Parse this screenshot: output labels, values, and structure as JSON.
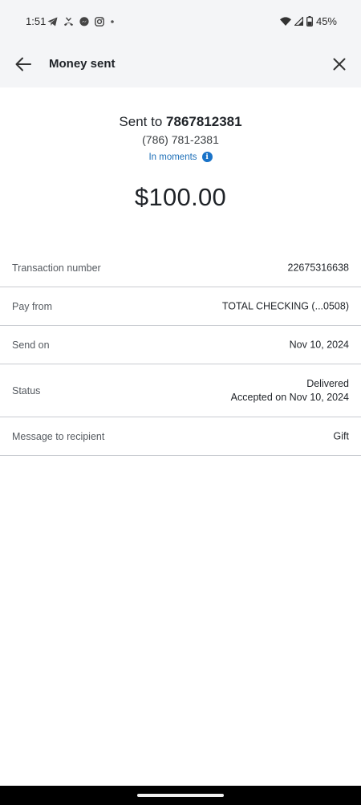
{
  "status_bar": {
    "time": "1:51",
    "battery": "45%",
    "icons": [
      "telegram-icon",
      "missed-call-icon",
      "messenger-icon",
      "instagram-icon",
      "notification-dot-icon",
      "wifi-icon",
      "signal-icon",
      "battery-icon"
    ]
  },
  "header": {
    "title": "Money sent",
    "back_icon": "arrow-left-icon",
    "close_icon": "close-icon"
  },
  "summary": {
    "sent_to_prefix": "Sent to",
    "recipient_number": "7867812381",
    "recipient_phone": "(786) 781-2381",
    "timing": "In moments",
    "amount": "$100.00"
  },
  "details": [
    {
      "label": "Transaction number",
      "value": "22675316638"
    },
    {
      "label": "Pay from",
      "value": "TOTAL CHECKING (...0508)"
    },
    {
      "label": "Send on",
      "value": "Nov 10, 2024"
    },
    {
      "label": "Status",
      "value": "Delivered",
      "subvalue": "Accepted on Nov 10, 2024"
    },
    {
      "label": "Message to recipient",
      "value": "Gift"
    }
  ],
  "colors": {
    "accent": "#1a73c8",
    "header_bg": "#f4f5f7",
    "divider": "#c9ccd1"
  }
}
